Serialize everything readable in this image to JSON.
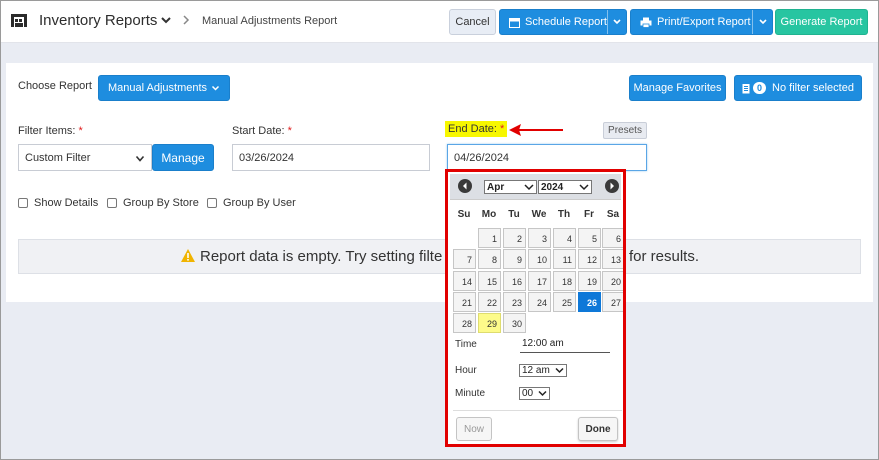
{
  "header": {
    "app_title": "Inventory Reports",
    "breadcrumb": "Manual Adjustments Report",
    "cancel_label": "Cancel",
    "schedule_label": "Schedule Report",
    "print_label": "Print/Export Report",
    "generate_label": "Generate Report"
  },
  "report": {
    "choose_label": "Choose Report",
    "selected_report": "Manual Adjustments",
    "manage_favorites": "Manage Favorites",
    "filter_count": "0",
    "filter_status": "No filter selected"
  },
  "filters": {
    "filter_items_label": "Filter Items:",
    "filter_items_value": "Custom Filter",
    "manage_label": "Manage",
    "start_date_label": "Start Date:",
    "start_date_value": "03/26/2024",
    "end_date_label": "End Date:",
    "end_date_value": "04/26/2024",
    "required_mark": "*",
    "presets_label": "Presets"
  },
  "options": {
    "show_details": "Show Details",
    "group_by_store": "Group By Store",
    "group_by_user": "Group By User"
  },
  "empty_state": {
    "message_start": "Report data is empty. Try setting filte",
    "message_end": "for results."
  },
  "datepicker": {
    "month": "Apr",
    "year": "2024",
    "weekdays": [
      "Su",
      "Mo",
      "Tu",
      "We",
      "Th",
      "Fr",
      "Sa"
    ],
    "days": [
      "1",
      "2",
      "3",
      "4",
      "5",
      "6",
      "7",
      "8",
      "9",
      "10",
      "11",
      "12",
      "13",
      "14",
      "15",
      "16",
      "17",
      "18",
      "19",
      "20",
      "21",
      "22",
      "23",
      "24",
      "25",
      "26",
      "27",
      "28",
      "29",
      "30"
    ],
    "selected_day": "26",
    "today_day": "29",
    "time_label": "Time",
    "time_value": "12:00 am",
    "hour_label": "Hour",
    "hour_value": "12 am",
    "minute_label": "Minute",
    "minute_value": "00",
    "now_label": "Now",
    "done_label": "Done"
  },
  "colors": {
    "primary": "#1e8ddf",
    "generate": "#27c5a1",
    "highlight": "#f7f700",
    "annotation": "#e10000",
    "selected_day": "#0e78d8",
    "today_day": "#fdfb8a"
  }
}
